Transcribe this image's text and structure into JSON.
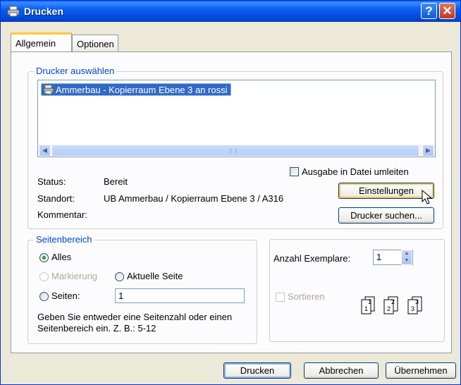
{
  "window": {
    "title": "Drucken",
    "help_button": "?",
    "close_button": "✕"
  },
  "tabs": [
    {
      "label": "Allgemein"
    },
    {
      "label": "Optionen"
    }
  ],
  "printer_group": {
    "title": "Drucker auswählen",
    "selected_printer": "Ammerbau - Kopierraum Ebene 3 an rossi",
    "print_to_file_label": "Ausgabe in Datei umleiten",
    "status_label": "Status:",
    "status_value": "Bereit",
    "location_label": "Standort:",
    "location_value": "UB Ammerbau / Kopierraum Ebene 3 / A316",
    "comment_label": "Kommentar:",
    "settings_button": "Einstellungen",
    "find_printer_button": "Drucker suchen..."
  },
  "page_range": {
    "title": "Seitenbereich",
    "all_label": "Alles",
    "selection_label": "Markierung",
    "current_page_label": "Aktuelle Seite",
    "pages_label": "Seiten:",
    "pages_value": "1",
    "hint": "Geben Sie entweder eine Seitenzahl oder einen Seitenbereich ein. Z. B.: 5-12"
  },
  "copies": {
    "label": "Anzahl Exemplare:",
    "value": "1",
    "collate_label": "Sortieren"
  },
  "footer": {
    "print_button": "Drucken",
    "cancel_button": "Abbrechen",
    "apply_button": "Übernehmen"
  }
}
